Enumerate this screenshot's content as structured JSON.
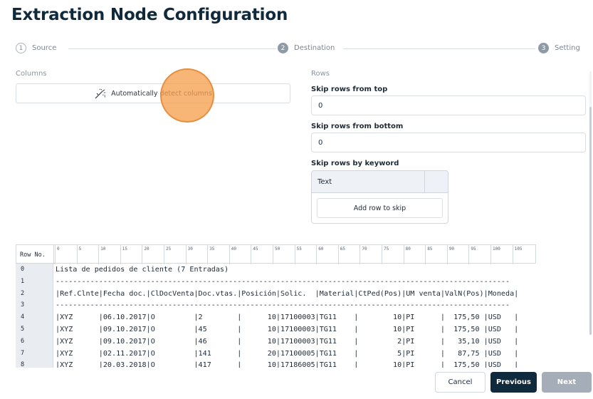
{
  "page": {
    "title": "Extraction Node Configuration"
  },
  "stepper": {
    "steps": [
      {
        "number": "1",
        "label": "Source"
      },
      {
        "number": "2",
        "label": "Destination"
      },
      {
        "number": "3",
        "label": "Setting"
      }
    ]
  },
  "columns": {
    "label": "Columns",
    "detect_button": "Automatically detect columns",
    "icon": "magic-wand-icon"
  },
  "rows": {
    "label": "Rows",
    "skip_top_label": "Skip rows from top",
    "skip_top_value": "0",
    "skip_bottom_label": "Skip rows from bottom",
    "skip_bottom_value": "0",
    "skip_keyword_label": "Skip rows by keyword",
    "keyword_header": "Text",
    "add_row_button": "Add row to skip"
  },
  "preview": {
    "row_no_header": "Row No.",
    "ruler_ticks": [
      "0",
      "5",
      "10",
      "15",
      "20",
      "25",
      "30",
      "35",
      "40",
      "45",
      "50",
      "55",
      "60",
      "65",
      "70",
      "75",
      "80",
      "85",
      "90",
      "95",
      "100",
      "105"
    ],
    "rows": [
      {
        "n": "0",
        "text": "Lista de pedidos de cliente (7 Entradas)"
      },
      {
        "n": "1",
        "text": "---------------------------------------------------------------------------------------------------------"
      },
      {
        "n": "2",
        "text": "|Ref.Clnte|Fecha doc.|ClDocVenta|Doc.vtas.|Posición|Solic.  |Material|CtPed(Pos)|UM venta|ValN(Pos)|Moneda|"
      },
      {
        "n": "3",
        "text": "---------------------------------------------------------------------------------------------------------"
      },
      {
        "n": "4",
        "text": "|XYZ      |06.10.2017|O         |2        |      10|17100003|TG11    |        10|PI      |  175,50 |USD   |"
      },
      {
        "n": "5",
        "text": "|XYZ      |09.10.2017|O         |45       |      10|17100003|TG11    |        10|PI      |  175,50 |USD   |"
      },
      {
        "n": "6",
        "text": "|XYZ      |09.10.2017|O         |46       |      10|17100003|TG11    |         2|PI      |   35,10 |USD   |"
      },
      {
        "n": "7",
        "text": "|XYZ      |02.11.2017|O         |141      |      20|17100005|TG11    |         5|PI      |   87,75 |USD   |"
      },
      {
        "n": "8",
        "text": "|XYZ      |20.03.2018|O         |417      |      10|17186005|TG11    |        10|PI      |  175,50 |USD   |"
      }
    ]
  },
  "footer": {
    "cancel": "Cancel",
    "previous": "Previous",
    "next": "Next"
  }
}
